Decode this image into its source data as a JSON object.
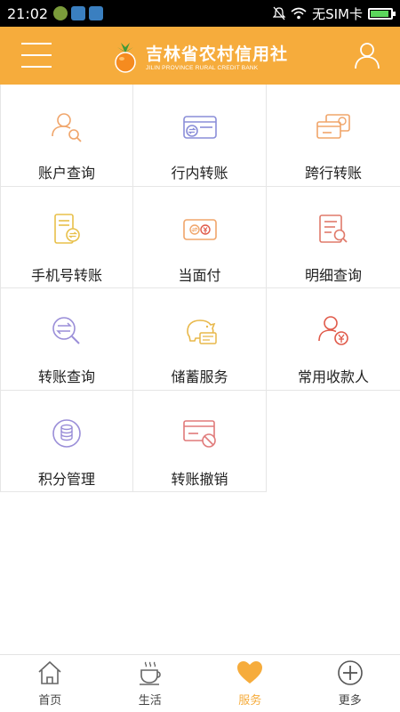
{
  "status_bar": {
    "time": "21:02",
    "carrier": "无SIM卡",
    "battery_level": 0.9
  },
  "header": {
    "brand_cn": "吉林省农村信用社",
    "brand_en": "JILIN PROVINCE RURAL CREDIT BANK",
    "accent_color": "#f6ac3c"
  },
  "services": [
    {
      "label": "账户查询",
      "icon": "account-search-icon"
    },
    {
      "label": "行内转账",
      "icon": "card-transfer-icon"
    },
    {
      "label": "跨行转账",
      "icon": "interbank-transfer-icon"
    },
    {
      "label": "手机号转账",
      "icon": "phone-transfer-icon"
    },
    {
      "label": "当面付",
      "icon": "face-pay-icon"
    },
    {
      "label": "明细查询",
      "icon": "detail-search-icon"
    },
    {
      "label": "转账查询",
      "icon": "transfer-search-icon"
    },
    {
      "label": "储蓄服务",
      "icon": "piggy-bank-icon"
    },
    {
      "label": "常用收款人",
      "icon": "payee-icon"
    },
    {
      "label": "积分管理",
      "icon": "points-icon"
    },
    {
      "label": "转账撤销",
      "icon": "transfer-cancel-icon"
    }
  ],
  "bottom_nav": [
    {
      "label": "首页",
      "icon": "home-icon"
    },
    {
      "label": "生活",
      "icon": "coffee-icon"
    },
    {
      "label": "服务",
      "icon": "heart-icon",
      "active": true
    },
    {
      "label": "更多",
      "icon": "plus-circle-icon"
    }
  ]
}
